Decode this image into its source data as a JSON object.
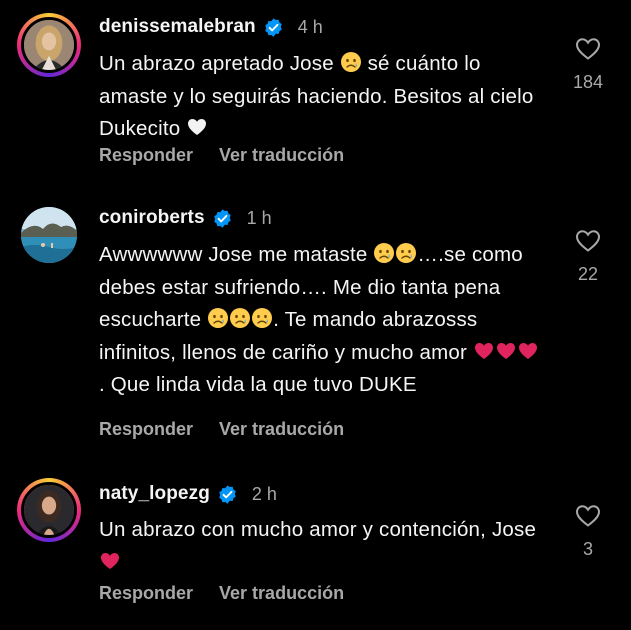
{
  "colors": {
    "background": "#000000",
    "text": "#f5f5f5",
    "secondary_text": "#a8a8a8",
    "verified_badge": "#0095f6",
    "heart_red": "#e0245e"
  },
  "comments": [
    {
      "username": "denissemalebran",
      "verified": true,
      "time": "4 h",
      "avatar_icon": "woman-portrait-avatar",
      "text_parts": [
        "Un abrazo apretado Jose ",
        " sé cuánto lo amaste y lo seguirás haciendo. Besitos al cielo Dukecito "
      ],
      "emojis": [
        "crying-face-emoji",
        "white-heart-emoji"
      ],
      "reply_label": "Responder",
      "translate_label": "Ver traducción",
      "like_icon": "heart-outline-icon",
      "likes": "184"
    },
    {
      "username": "coniroberts",
      "verified": true,
      "time": "1 h",
      "avatar_icon": "beach-landscape-avatar",
      "text_parts": [
        "Awwwwww Jose me mataste ",
        "….se como debes estar sufriendo…. Me dio tanta pena escucharte ",
        ". Te mando abrazosss infinitos, llenos de cariño y mucho amor ",
        ". Que linda vida la que tuvo DUKE"
      ],
      "emojis": [
        "crying-face-emoji",
        "red-heart-emoji"
      ],
      "reply_label": "Responder",
      "translate_label": "Ver traducción",
      "like_icon": "heart-outline-icon",
      "likes": "22"
    },
    {
      "username": "naty_lopezg",
      "verified": true,
      "time": "2 h",
      "avatar_icon": "woman-portrait-avatar",
      "text_parts": [
        "Un abrazo con mucho amor y contención, Jose "
      ],
      "emojis": [
        "red-heart-emoji"
      ],
      "reply_label": "Responder",
      "translate_label": "Ver traducción",
      "like_icon": "heart-outline-icon",
      "likes": "3"
    }
  ]
}
